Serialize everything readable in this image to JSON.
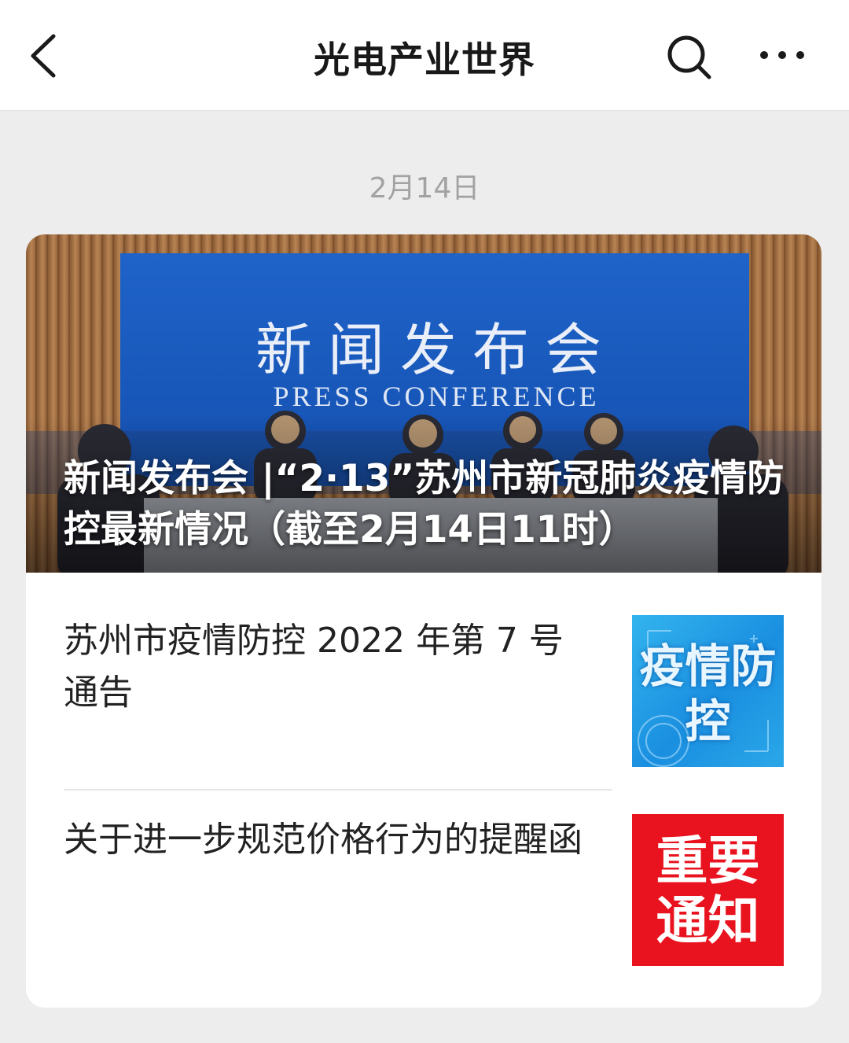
{
  "header": {
    "title": "光电产业世界",
    "back_icon": "chevron-left-icon",
    "search_icon": "search-icon",
    "more_icon": "more-horizontal-icon"
  },
  "feed": {
    "date": "2月14日",
    "hero": {
      "banner_title": "新闻发布会",
      "banner_subtitle": "PRESS    CONFERENCE",
      "title": "新闻发布会 |“2·13”苏州市新冠肺炎疫情防控最新情况（截至2月14日11时）"
    },
    "articles": [
      {
        "title": "苏州市疫情防控 2022 年第 7 号通告",
        "thumb_text": "疫情防控",
        "thumb_color": "#1a8fe0"
      },
      {
        "title": "关于进一步规范价格行为的提醒函",
        "thumb_text": "重要通知",
        "thumb_color": "#e8131e"
      }
    ]
  }
}
